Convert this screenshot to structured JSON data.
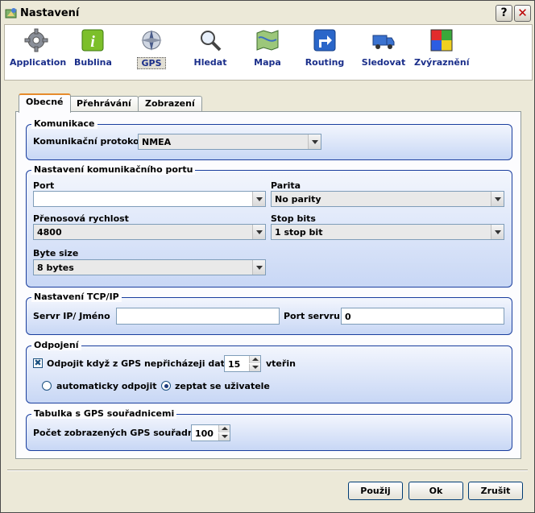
{
  "window": {
    "title": "Nastavení",
    "help_label": "?",
    "close_label": "✕"
  },
  "toolbar": [
    {
      "label": "Application",
      "icon": "gear-icon"
    },
    {
      "label": "Bublina",
      "icon": "info-icon"
    },
    {
      "label": "GPS",
      "icon": "gps-compass-icon"
    },
    {
      "label": "Hledat",
      "icon": "magnifier-icon"
    },
    {
      "label": "Mapa",
      "icon": "map-icon"
    },
    {
      "label": "Routing",
      "icon": "route-sign-icon"
    },
    {
      "label": "Sledovat",
      "icon": "truck-icon"
    },
    {
      "label": "Zvýraznění",
      "icon": "color-squares-icon"
    }
  ],
  "tabs": [
    "Obecné",
    "Přehrávání",
    "Zobrazení"
  ],
  "komunikace": {
    "title": "Komunikace",
    "protocol_label": "Komunikační protokol",
    "protocol_value": "NMEA"
  },
  "port_settings": {
    "title": "Nastavení komunikačního portu",
    "port_label": "Port",
    "port_value": "",
    "parity_label": "Parita",
    "parity_value": "No parity",
    "baud_label": "Přenosová rychlost",
    "baud_value": "4800",
    "stopbits_label": "Stop bits",
    "stopbits_value": "1 stop bit",
    "bytesize_label": "Byte size",
    "bytesize_value": "8 bytes"
  },
  "tcp": {
    "title": "Nastavení TCP/IP",
    "server_label": "Servr IP/ Jméno",
    "server_value": "",
    "port_label": "Port servru",
    "port_value": "0"
  },
  "odpojeni": {
    "title": "Odpojení",
    "checkbox_label": "Odpojit když z GPS nepřicházeji data",
    "checkbox_checked": true,
    "seconds_value": "15",
    "seconds_unit": "vteřin",
    "radio_auto": "automaticky odpojit",
    "radio_ask": "zeptat se uživatele"
  },
  "gps_table": {
    "title": "Tabulka s GPS souřadnicemi",
    "count_label": "Počet zobrazených GPS souřadnic",
    "count_value": "100"
  },
  "buttons": {
    "apply": "Použij",
    "ok": "Ok",
    "cancel": "Zrušit"
  }
}
